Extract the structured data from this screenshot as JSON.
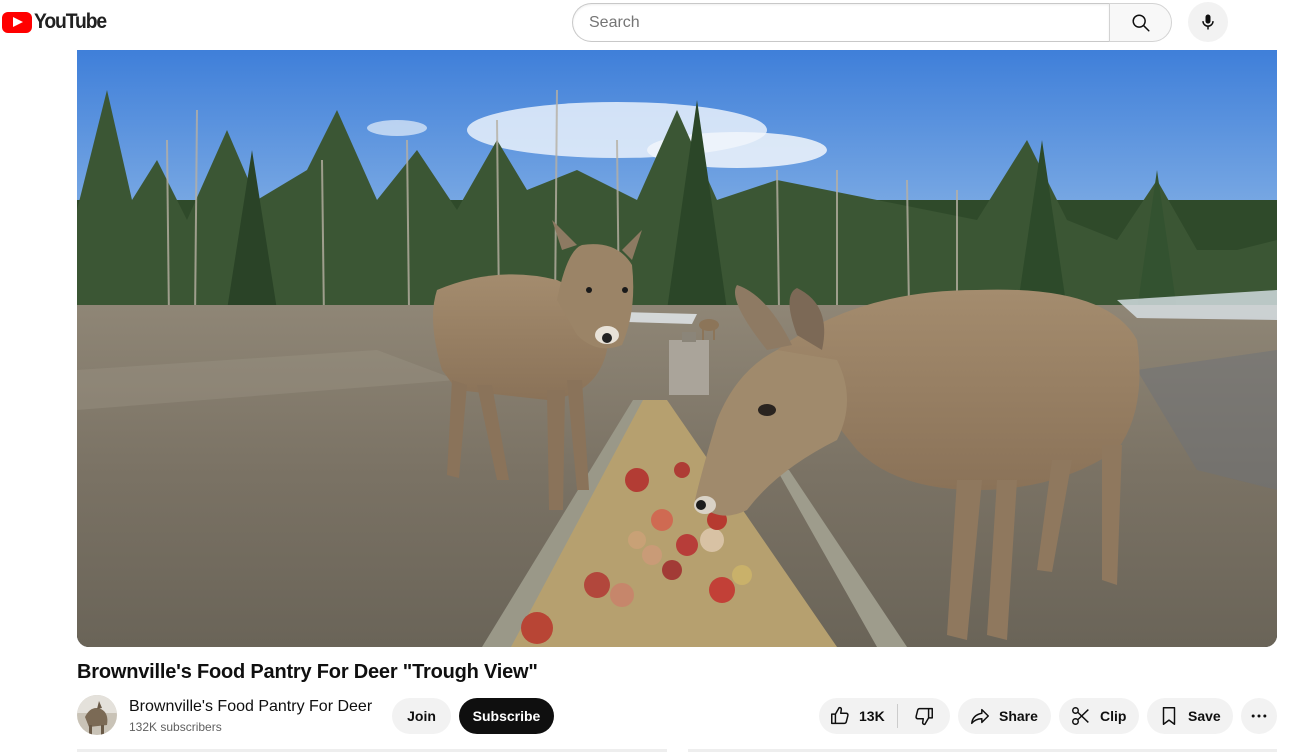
{
  "masthead": {
    "logo_text": "YouTube",
    "search": {
      "placeholder": "Search",
      "value": ""
    },
    "icons": {
      "search": "search-icon",
      "mic": "mic-icon"
    }
  },
  "player": {
    "scene": "two white-tailed deer eating apples and grain from a wooden trough, pine forest and blue sky behind",
    "colors": {
      "sky_top": "#3f7fd9",
      "sky_bottom": "#9ec3ea",
      "ground": "#8a8272",
      "deer": "#9b8467"
    }
  },
  "video": {
    "title": "Brownville's Food Pantry For Deer \"Trough View\""
  },
  "owner": {
    "channel_name": "Brownville's Food Pantry For Deer",
    "subscribers": "132K subscribers",
    "join_label": "Join",
    "subscribe_label": "Subscribe"
  },
  "actions": {
    "like_count": "13K",
    "share_label": "Share",
    "clip_label": "Clip",
    "save_label": "Save",
    "icons": [
      "thumbs-up-icon",
      "thumbs-down-icon",
      "share-icon",
      "scissors-icon",
      "bookmark-icon",
      "more-icon"
    ]
  },
  "colors": {
    "brand_red": "#ff0000",
    "subscribe_bg": "#0f0f0f",
    "pill_bg": "#f2f2f2"
  }
}
